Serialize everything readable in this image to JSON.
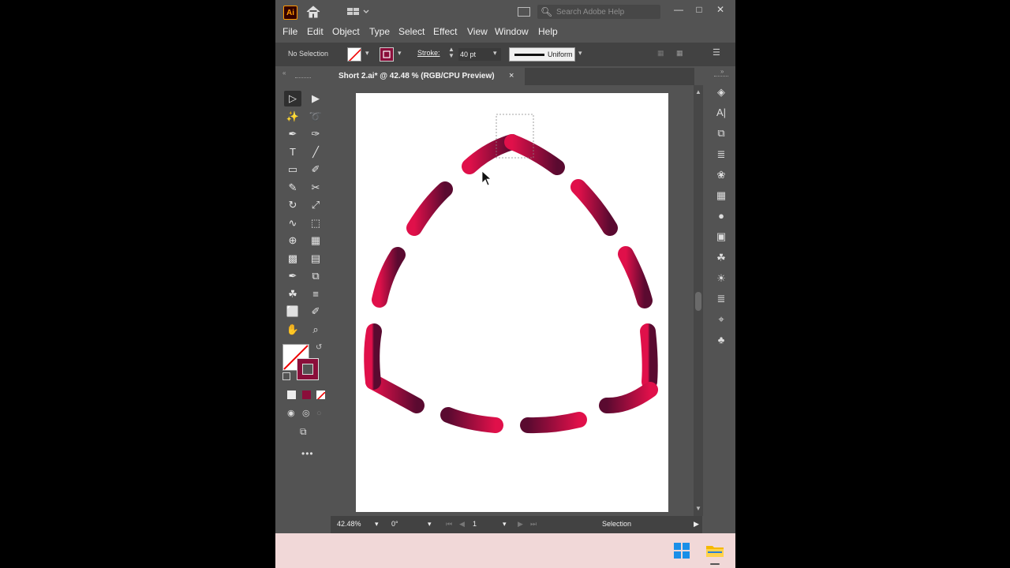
{
  "app": {
    "logo": "Ai",
    "search_placeholder": "Search Adobe Help"
  },
  "menu": [
    "File",
    "Edit",
    "Object",
    "Type",
    "Select",
    "Effect",
    "View",
    "Window",
    "Help"
  ],
  "control_bar": {
    "selection_label": "No Selection",
    "stroke_label": "Stroke:",
    "stroke_value": "40 pt",
    "profile_label": "Uniform"
  },
  "document": {
    "tab_title": "Short 2.ai* @ 42.48 % (RGB/CPU Preview)",
    "close_glyph": "×"
  },
  "status": {
    "zoom": "42.48%",
    "rotation": "0°",
    "artboard": "1",
    "tool": "Selection"
  },
  "colors": {
    "accent": "#8a0e3a",
    "gradient_start": "#5a0a30",
    "gradient_end": "#e0104a",
    "ui_bg": "#535353",
    "taskbar_bg": "#f1d8d8"
  },
  "icons": {
    "toolbar": [
      "selection-tool-icon",
      "direct-selection-tool-icon",
      "magic-wand-icon",
      "lasso-icon",
      "pen-tool-icon",
      "curvature-tool-icon",
      "type-tool-icon",
      "line-tool-icon",
      "rectangle-tool-icon",
      "paintbrush-icon",
      "shaper-tool-icon",
      "scissors-icon",
      "rotate-tool-icon",
      "scale-tool-icon",
      "warp-tool-icon",
      "free-transform-icon",
      "shape-builder-icon",
      "perspective-grid-icon",
      "mesh-tool-icon",
      "gradient-tool-icon",
      "eyedropper-icon",
      "blend-tool-icon",
      "symbol-sprayer-icon",
      "graph-tool-icon",
      "artboard-tool-icon",
      "slice-tool-icon",
      "hand-tool-icon",
      "zoom-tool-icon"
    ],
    "right_panel": [
      "layers-icon",
      "character-icon",
      "libraries-icon",
      "align-icon",
      "color-icon",
      "swatches-icon",
      "brushes-icon",
      "stroke-icon",
      "symbols-icon",
      "appearance-icon",
      "properties-icon",
      "transform-icon",
      "club-icon"
    ]
  }
}
